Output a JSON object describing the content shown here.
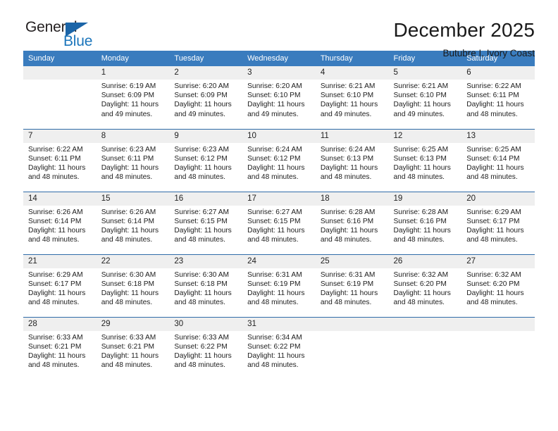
{
  "logo": {
    "word_one": "General",
    "word_two": "Blue",
    "triangle_color": "#1b65a8",
    "blue_color": "#1b75bb"
  },
  "header": {
    "title": "December 2025",
    "subtitle": "Butubre I, Ivory Coast"
  },
  "theme": {
    "header_blue": "#3a7cbe",
    "row_divider_blue": "#2f6ba8",
    "daynum_band": "#efefef"
  },
  "labels": {
    "sunrise_prefix": "Sunrise:",
    "sunset_prefix": "Sunset:",
    "daylight_prefix": "Daylight:"
  },
  "weekday_headers": [
    "Sunday",
    "Monday",
    "Tuesday",
    "Wednesday",
    "Thursday",
    "Friday",
    "Saturday"
  ],
  "weeks": [
    [
      {
        "day": "",
        "empty": true
      },
      {
        "day": "1",
        "sunrise": "Sunrise: 6:19 AM",
        "sunset": "Sunset: 6:09 PM",
        "daylight_line1": "Daylight: 11 hours",
        "daylight_line2": "and 49 minutes."
      },
      {
        "day": "2",
        "sunrise": "Sunrise: 6:20 AM",
        "sunset": "Sunset: 6:09 PM",
        "daylight_line1": "Daylight: 11 hours",
        "daylight_line2": "and 49 minutes."
      },
      {
        "day": "3",
        "sunrise": "Sunrise: 6:20 AM",
        "sunset": "Sunset: 6:10 PM",
        "daylight_line1": "Daylight: 11 hours",
        "daylight_line2": "and 49 minutes."
      },
      {
        "day": "4",
        "sunrise": "Sunrise: 6:21 AM",
        "sunset": "Sunset: 6:10 PM",
        "daylight_line1": "Daylight: 11 hours",
        "daylight_line2": "and 49 minutes."
      },
      {
        "day": "5",
        "sunrise": "Sunrise: 6:21 AM",
        "sunset": "Sunset: 6:10 PM",
        "daylight_line1": "Daylight: 11 hours",
        "daylight_line2": "and 49 minutes."
      },
      {
        "day": "6",
        "sunrise": "Sunrise: 6:22 AM",
        "sunset": "Sunset: 6:11 PM",
        "daylight_line1": "Daylight: 11 hours",
        "daylight_line2": "and 48 minutes."
      }
    ],
    [
      {
        "day": "7",
        "sunrise": "Sunrise: 6:22 AM",
        "sunset": "Sunset: 6:11 PM",
        "daylight_line1": "Daylight: 11 hours",
        "daylight_line2": "and 48 minutes."
      },
      {
        "day": "8",
        "sunrise": "Sunrise: 6:23 AM",
        "sunset": "Sunset: 6:11 PM",
        "daylight_line1": "Daylight: 11 hours",
        "daylight_line2": "and 48 minutes."
      },
      {
        "day": "9",
        "sunrise": "Sunrise: 6:23 AM",
        "sunset": "Sunset: 6:12 PM",
        "daylight_line1": "Daylight: 11 hours",
        "daylight_line2": "and 48 minutes."
      },
      {
        "day": "10",
        "sunrise": "Sunrise: 6:24 AM",
        "sunset": "Sunset: 6:12 PM",
        "daylight_line1": "Daylight: 11 hours",
        "daylight_line2": "and 48 minutes."
      },
      {
        "day": "11",
        "sunrise": "Sunrise: 6:24 AM",
        "sunset": "Sunset: 6:13 PM",
        "daylight_line1": "Daylight: 11 hours",
        "daylight_line2": "and 48 minutes."
      },
      {
        "day": "12",
        "sunrise": "Sunrise: 6:25 AM",
        "sunset": "Sunset: 6:13 PM",
        "daylight_line1": "Daylight: 11 hours",
        "daylight_line2": "and 48 minutes."
      },
      {
        "day": "13",
        "sunrise": "Sunrise: 6:25 AM",
        "sunset": "Sunset: 6:14 PM",
        "daylight_line1": "Daylight: 11 hours",
        "daylight_line2": "and 48 minutes."
      }
    ],
    [
      {
        "day": "14",
        "sunrise": "Sunrise: 6:26 AM",
        "sunset": "Sunset: 6:14 PM",
        "daylight_line1": "Daylight: 11 hours",
        "daylight_line2": "and 48 minutes."
      },
      {
        "day": "15",
        "sunrise": "Sunrise: 6:26 AM",
        "sunset": "Sunset: 6:14 PM",
        "daylight_line1": "Daylight: 11 hours",
        "daylight_line2": "and 48 minutes."
      },
      {
        "day": "16",
        "sunrise": "Sunrise: 6:27 AM",
        "sunset": "Sunset: 6:15 PM",
        "daylight_line1": "Daylight: 11 hours",
        "daylight_line2": "and 48 minutes."
      },
      {
        "day": "17",
        "sunrise": "Sunrise: 6:27 AM",
        "sunset": "Sunset: 6:15 PM",
        "daylight_line1": "Daylight: 11 hours",
        "daylight_line2": "and 48 minutes."
      },
      {
        "day": "18",
        "sunrise": "Sunrise: 6:28 AM",
        "sunset": "Sunset: 6:16 PM",
        "daylight_line1": "Daylight: 11 hours",
        "daylight_line2": "and 48 minutes."
      },
      {
        "day": "19",
        "sunrise": "Sunrise: 6:28 AM",
        "sunset": "Sunset: 6:16 PM",
        "daylight_line1": "Daylight: 11 hours",
        "daylight_line2": "and 48 minutes."
      },
      {
        "day": "20",
        "sunrise": "Sunrise: 6:29 AM",
        "sunset": "Sunset: 6:17 PM",
        "daylight_line1": "Daylight: 11 hours",
        "daylight_line2": "and 48 minutes."
      }
    ],
    [
      {
        "day": "21",
        "sunrise": "Sunrise: 6:29 AM",
        "sunset": "Sunset: 6:17 PM",
        "daylight_line1": "Daylight: 11 hours",
        "daylight_line2": "and 48 minutes."
      },
      {
        "day": "22",
        "sunrise": "Sunrise: 6:30 AM",
        "sunset": "Sunset: 6:18 PM",
        "daylight_line1": "Daylight: 11 hours",
        "daylight_line2": "and 48 minutes."
      },
      {
        "day": "23",
        "sunrise": "Sunrise: 6:30 AM",
        "sunset": "Sunset: 6:18 PM",
        "daylight_line1": "Daylight: 11 hours",
        "daylight_line2": "and 48 minutes."
      },
      {
        "day": "24",
        "sunrise": "Sunrise: 6:31 AM",
        "sunset": "Sunset: 6:19 PM",
        "daylight_line1": "Daylight: 11 hours",
        "daylight_line2": "and 48 minutes."
      },
      {
        "day": "25",
        "sunrise": "Sunrise: 6:31 AM",
        "sunset": "Sunset: 6:19 PM",
        "daylight_line1": "Daylight: 11 hours",
        "daylight_line2": "and 48 minutes."
      },
      {
        "day": "26",
        "sunrise": "Sunrise: 6:32 AM",
        "sunset": "Sunset: 6:20 PM",
        "daylight_line1": "Daylight: 11 hours",
        "daylight_line2": "and 48 minutes."
      },
      {
        "day": "27",
        "sunrise": "Sunrise: 6:32 AM",
        "sunset": "Sunset: 6:20 PM",
        "daylight_line1": "Daylight: 11 hours",
        "daylight_line2": "and 48 minutes."
      }
    ],
    [
      {
        "day": "28",
        "sunrise": "Sunrise: 6:33 AM",
        "sunset": "Sunset: 6:21 PM",
        "daylight_line1": "Daylight: 11 hours",
        "daylight_line2": "and 48 minutes."
      },
      {
        "day": "29",
        "sunrise": "Sunrise: 6:33 AM",
        "sunset": "Sunset: 6:21 PM",
        "daylight_line1": "Daylight: 11 hours",
        "daylight_line2": "and 48 minutes."
      },
      {
        "day": "30",
        "sunrise": "Sunrise: 6:33 AM",
        "sunset": "Sunset: 6:22 PM",
        "daylight_line1": "Daylight: 11 hours",
        "daylight_line2": "and 48 minutes."
      },
      {
        "day": "31",
        "sunrise": "Sunrise: 6:34 AM",
        "sunset": "Sunset: 6:22 PM",
        "daylight_line1": "Daylight: 11 hours",
        "daylight_line2": "and 48 minutes."
      },
      {
        "day": "",
        "empty": true
      },
      {
        "day": "",
        "empty": true
      },
      {
        "day": "",
        "empty": true
      }
    ]
  ]
}
